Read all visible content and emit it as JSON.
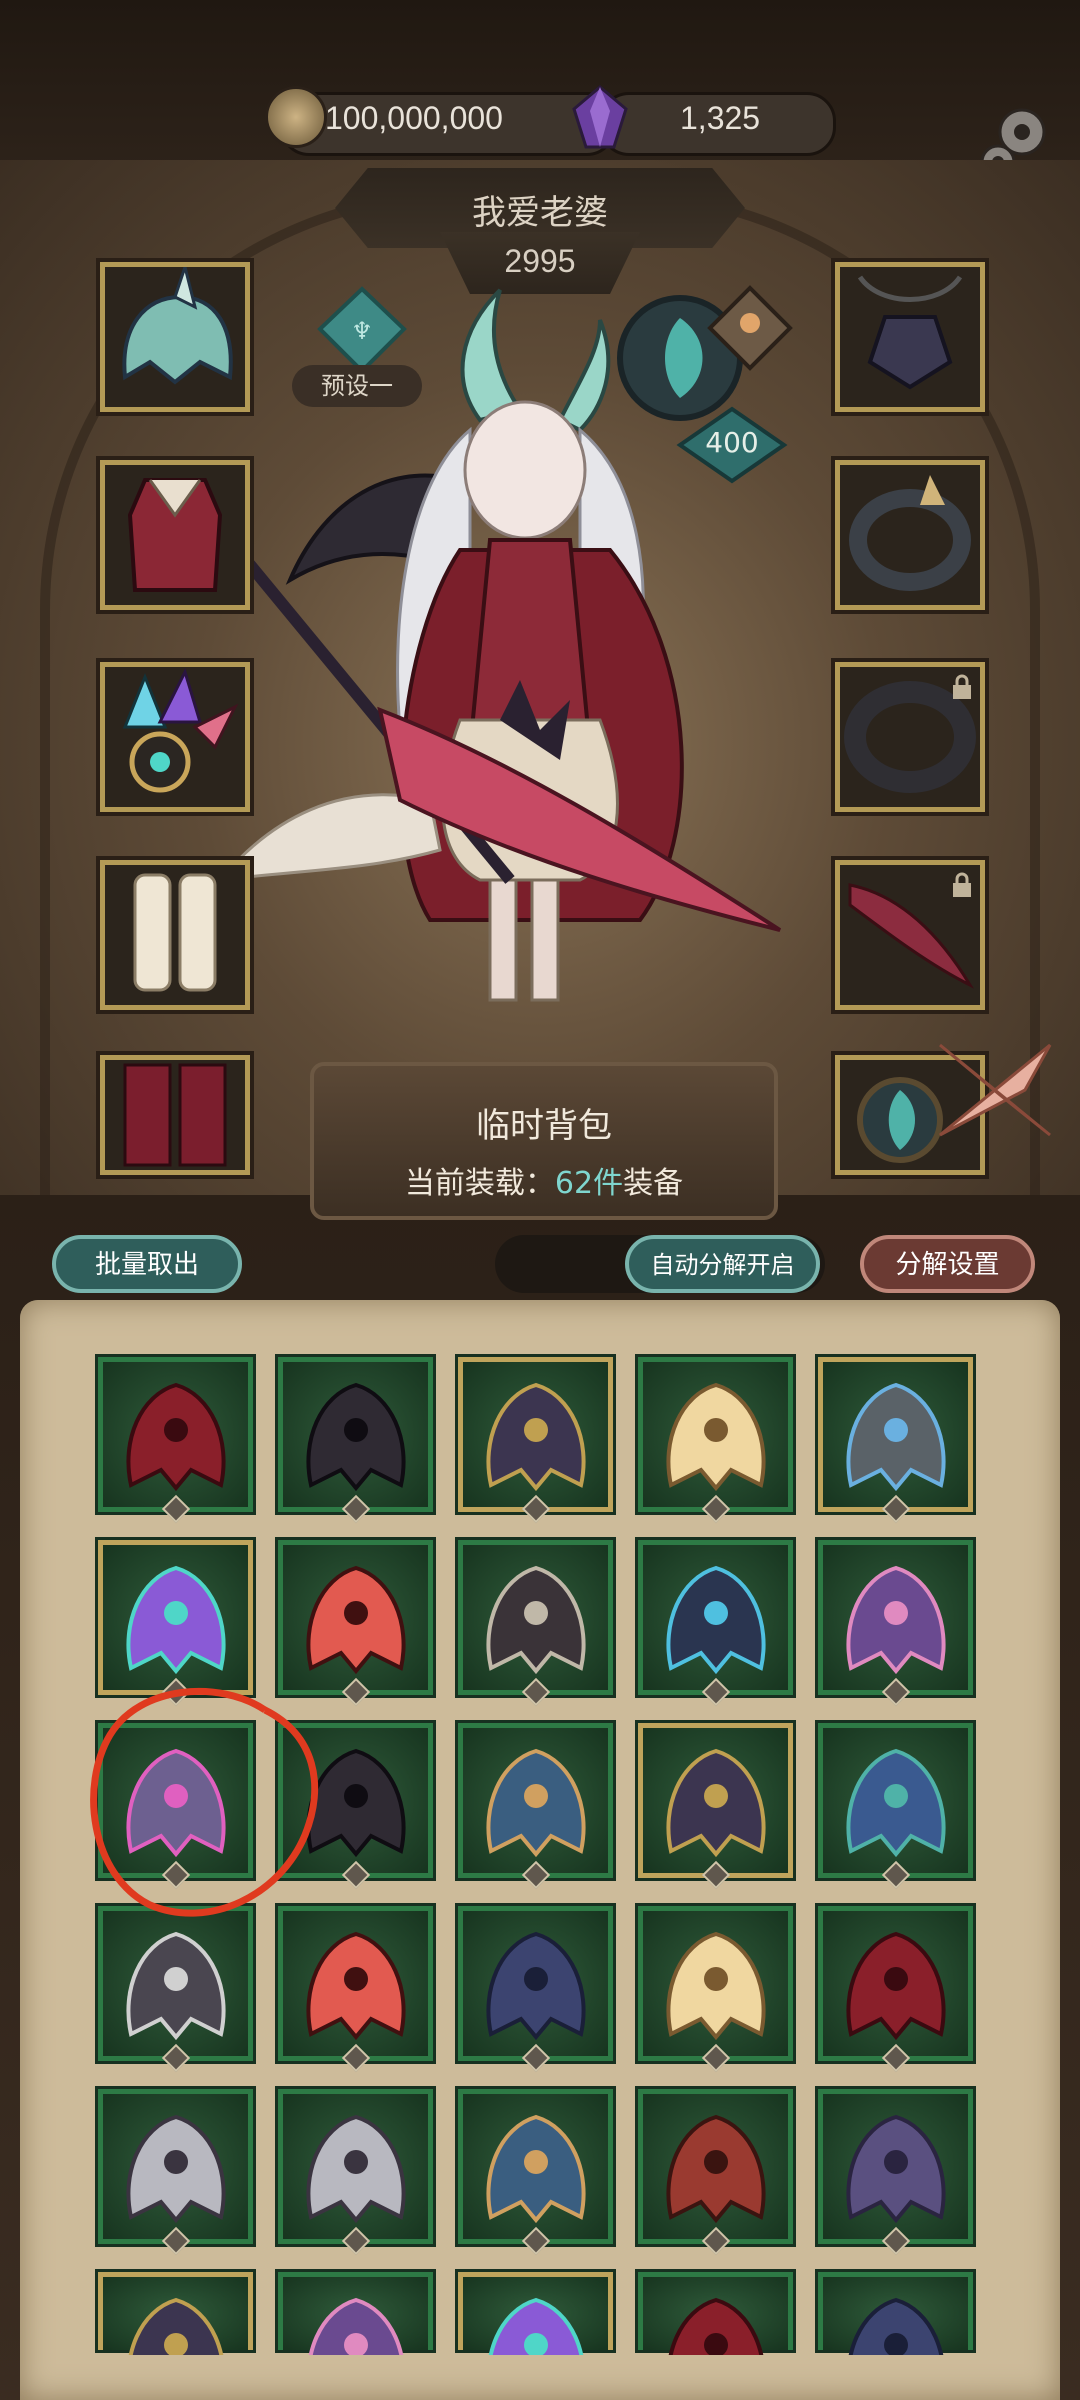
{
  "currency": {
    "gold": "100,000,000",
    "gems": "1,325"
  },
  "player": {
    "name": "我爱老婆",
    "power": "2995"
  },
  "preset_label": "预设一",
  "pet_level": "400",
  "bag": {
    "title": "临时背包",
    "capacity_prefix": "当前装载：",
    "capacity_count": "62件",
    "capacity_suffix": "装备"
  },
  "buttons": {
    "batch_take": "批量取出",
    "auto_decompose": "自动分解开启",
    "decompose_settings": "分解设置"
  },
  "colors": {
    "accent_teal": "#7fd6cf",
    "highlight_circle": "#e03a1f"
  },
  "left_slots": [
    "helmet-icon",
    "armor-icon",
    "gauntlet-icon",
    "boots-icon",
    "leg-guard-icon"
  ],
  "right_slots": [
    "amulet-icon",
    "bracelet-icon",
    "ring-icon",
    "weapon-icon",
    "emblem-icon"
  ],
  "items": [
    "red-greaves-icon",
    "dark-hood-icon",
    "spiked-boots-icon",
    "feather-blade-icon",
    "clockwork-gauntlet-icon",
    "crystal-gauntlet-icon",
    "flame-crown-icon",
    "dark-robe-icon",
    "horned-helm-icon",
    "violet-armor-icon",
    "violet-bracer-icon",
    "dark-hood-icon",
    "blue-bracer-icon",
    "spiked-boots-icon",
    "blue-coat-icon",
    "spiked-heels-icon",
    "flame-crown-icon",
    "blue-greaves-icon",
    "feather-blade-icon",
    "red-greaves-icon",
    "spiked-bracer-icon",
    "spiked-bracer-icon",
    "blue-bracer-icon",
    "red-shoulder-icon",
    "violet-greaves-icon",
    "spiked-boots-icon",
    "violet-armor-icon",
    "crystal-gauntlet-icon",
    "red-greaves-icon",
    "blue-greaves-icon"
  ]
}
